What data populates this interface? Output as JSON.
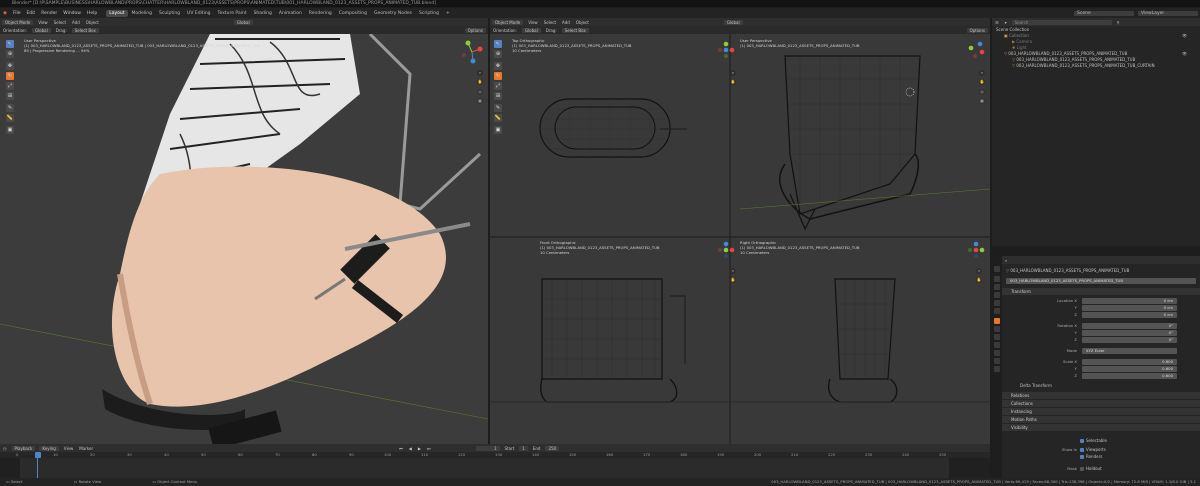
{
  "title_bar": {
    "text": "Blender* [D:\\P\\SAMPLE\\BUSINESS\\HARLOWBLAND\\PROPS\\CHATTER\\HARLOWBLAND_0123\\ASSETS\\PROPS\\ANIMATED\\TUB\\001_HARLOWBLAND_0123_ASSETS_PROPS_ANIMATED_TUB.blend]"
  },
  "menu": [
    "File",
    "Edit",
    "Render",
    "Window",
    "Help"
  ],
  "workspaces": [
    "Layout",
    "Modeling",
    "Sculpting",
    "UV Editing",
    "Texture Paint",
    "Shading",
    "Animation",
    "Rendering",
    "Compositing",
    "Geometry Nodes",
    "Scripting"
  ],
  "active_workspace": "Layout",
  "scene": {
    "name": "Scene",
    "view_layer": "ViewLayer"
  },
  "left_viewport": {
    "mode": "Object Mode",
    "menus": [
      "View",
      "Select",
      "Add",
      "Object"
    ],
    "orientation_label": "Orientation:",
    "orientation": "Global",
    "drag_label": "Drag:",
    "drag": "Select Box",
    "transform": "Global",
    "options": "Options",
    "info_view": "User Perspective",
    "info_object": "(1) 003_HARLOWBLAND_0123_ASSETS_PROPS_ANIMATED_TUB | 003_HARLOWBLAND_0123_ASSETS_PROPS_ANIMATED_TUB",
    "info_progress": "89 | Progressive Rendering ... 94%"
  },
  "right_viewport": {
    "mode": "Object Mode",
    "menus": [
      "View",
      "Select",
      "Add",
      "Object"
    ],
    "orientation_label": "Orientation:",
    "orientation": "Global",
    "drag_label": "Drag:",
    "drag": "Select Box",
    "transform": "Global",
    "options": "Options",
    "quads": [
      {
        "title": "Top Orthographic",
        "object": "(1) 003_HARLOWBLAND_0123_ASSETS_PROPS_ANIMATED_TUB",
        "units": "10 Centimeters"
      },
      {
        "title": "User Perspective",
        "object": "(1) 003_HARLOWBLAND_0123_ASSETS_PROPS_ANIMATED_TUB",
        "units": ""
      },
      {
        "title": "Front Orthographic",
        "object": "(1) 003_HARLOWBLAND_0123_ASSETS_PROPS_ANIMATED_TUB",
        "units": "10 Centimeters"
      },
      {
        "title": "Right Orthographic",
        "object": "(1) 003_HARLOWBLAND_0123_ASSETS_PROPS_ANIMATED_TUB",
        "units": "10 Centimeters"
      }
    ]
  },
  "outliner": {
    "search_placeholder": "Search",
    "items": [
      "Scene Collection",
      "Collection",
      "Camera",
      "Light",
      "003_HARLOWBLAND_0123_ASSETS_PROPS_ANIMATED_TUB",
      "003_HARLOWBLAND_0123_ASSETS_PROPS_ANIMATED_TUB",
      "003_HARLOWBLAND_0123_ASSETS_PROPS_ANIMATED_TUB_CURTAIN"
    ]
  },
  "properties": {
    "object_name": "003_HARLOWBLAND_0123_ASSETS_PROPS_ANIMATED_TUB",
    "mesh_name": "003_HARLOWBLAND_0123_ASSETS_PROPS_ANIMATED_TUB",
    "transform_header": "Transform",
    "location": {
      "label_x": "Location X",
      "label_y": "Y",
      "label_z": "Z",
      "x": "0 cm",
      "y": "0 cm",
      "z": "0 cm"
    },
    "rotation": {
      "label_x": "Rotation X",
      "label_y": "Y",
      "label_z": "Z",
      "x": "0°",
      "y": "0°",
      "z": "0°"
    },
    "mode": {
      "label": "Mode",
      "value": "XYZ Euler"
    },
    "scale": {
      "label_x": "Scale X",
      "label_y": "Y",
      "label_z": "Z",
      "x": "0.600",
      "y": "0.600",
      "z": "0.600"
    },
    "delta": "Delta Transform",
    "sections": [
      "Relations",
      "Collections",
      "Instancing",
      "Motion Paths",
      "Visibility"
    ],
    "visibility": {
      "selectable": "Selectable",
      "show_in": "Show In",
      "viewports": "Viewports",
      "renders": "Renders",
      "mask": "Mask",
      "holdout": "Holdout"
    }
  },
  "timeline": {
    "menus": [
      "Playback",
      "Keying",
      "View",
      "Marker"
    ],
    "current_frame": "1",
    "start_label": "Start",
    "start": "1",
    "end_label": "End",
    "end": "250",
    "ticks": [
      "0",
      "10",
      "20",
      "30",
      "40",
      "50",
      "60",
      "70",
      "80",
      "90",
      "100",
      "110",
      "120",
      "130",
      "140",
      "150",
      "160",
      "170",
      "180",
      "190",
      "200",
      "210",
      "220",
      "230",
      "240",
      "250"
    ]
  },
  "status_bar": {
    "select": "Select",
    "rotate": "Rotate View",
    "context": "Object Context Menu",
    "stats": "003_HARLOWBLAND_0123_ASSETS_PROPS_ANIMATED_TUB | 003_HARLOWBLAND_0123_ASSETS_PROPS_ANIMATED_TUB | Verts:69,419 | Faces:68,300 | Tris:138,398 | Objects:0/2 | Memory: 72.8 MiB | VRAM: 1.3/8.0 GiB | 3.1"
  },
  "colors": {
    "accent": "#5680c2",
    "active_orange": "#e8772e",
    "x_axis": "#e8453c",
    "y_axis": "#8ccf3a",
    "z_axis": "#3f8bdc"
  }
}
